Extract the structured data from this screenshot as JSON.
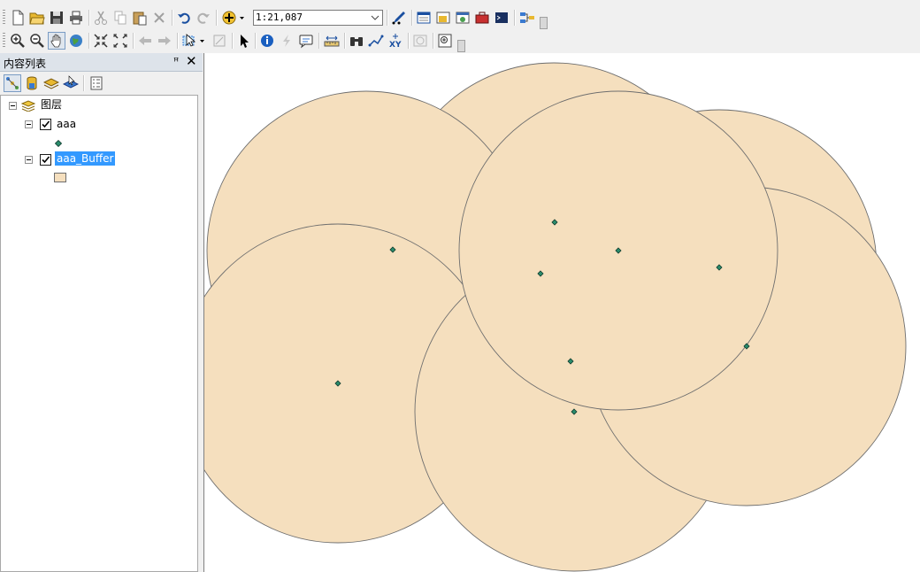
{
  "toolbar": {
    "scale_value": "1:21,087",
    "row1_icons": [
      "new-document-icon",
      "open-folder-icon",
      "save-icon",
      "print-icon",
      "cut-icon",
      "copy-icon",
      "paste-icon",
      "delete-icon",
      "undo-icon",
      "redo-icon",
      "add-data-icon",
      "editor-toolbar-icon",
      "table-of-contents-icon",
      "catalog-icon",
      "search-window-icon",
      "arctoolbox-icon",
      "python-window-icon",
      "model-builder-icon"
    ],
    "row2_icons": [
      "zoom-in-icon",
      "zoom-out-icon",
      "pan-icon",
      "full-extent-icon",
      "fixed-zoom-in-icon",
      "fixed-zoom-out-icon",
      "back-extent-icon",
      "forward-extent-icon",
      "select-features-icon",
      "clear-selection-icon",
      "select-elements-icon",
      "identify-icon",
      "hyperlink-icon",
      "html-popup-icon",
      "measure-icon",
      "find-icon",
      "find-route-icon",
      "go-to-xy-icon",
      "time-slider-icon",
      "magnifier-icon"
    ]
  },
  "toc": {
    "title": "内容列表",
    "pin": "ꟸ",
    "close": "✕",
    "tool_icons": [
      "list-by-drawing-order-icon",
      "list-by-source-icon",
      "list-by-visibility-icon",
      "list-by-selection-icon",
      "options-icon"
    ],
    "root_label": "图层",
    "layers": [
      {
        "name": "aaa",
        "checked": true,
        "selected": false,
        "symbol": "point",
        "symbol_color": "#2a8c6c"
      },
      {
        "name": "aaa_Buffer",
        "checked": true,
        "selected": true,
        "symbol": "polygon",
        "symbol_color": "#f5dfbe"
      }
    ]
  },
  "map": {
    "fill_color": "#f5dfbe",
    "outline_color": "#6e6e6e",
    "point_color": "#2a8c6c",
    "buffer_count": 7,
    "point_count": 9
  }
}
